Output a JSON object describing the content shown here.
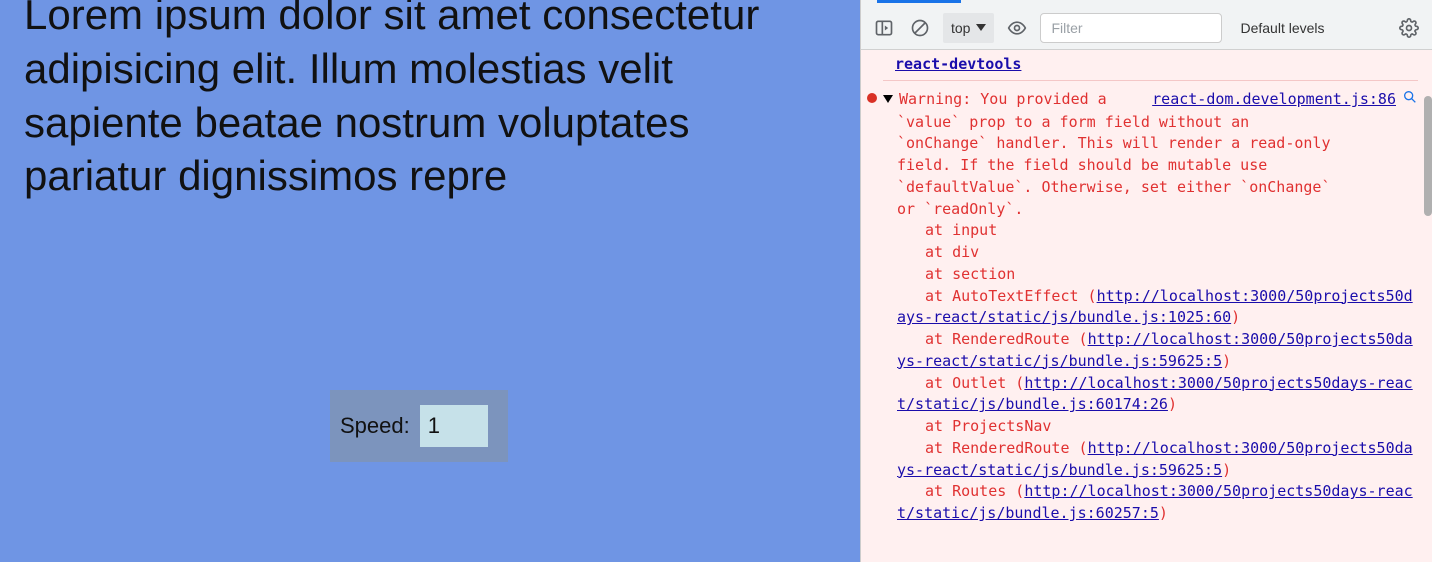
{
  "app": {
    "typing_text": "Lorem ipsum dolor sit amet consectetur adipisicing elit. Illum molestias velit sapiente beatae nostrum voluptates pariatur dignissimos repre",
    "speed_label": "Speed:",
    "speed_value": "1"
  },
  "devtools": {
    "toolbar": {
      "context": "top",
      "filter_placeholder": "Filter",
      "levels_label": "Default levels"
    },
    "prev_entry_link": "react-devtools",
    "warning": {
      "head_text": "Warning: You provided a",
      "source_link": "react-dom.development.js:86",
      "body_lines": [
        "`value` prop to a form field without an",
        "`onChange` handler. This will render a read-only",
        "field. If the field should be mutable use",
        "`defaultValue`. Otherwise, set either `onChange`",
        "or `readOnly`."
      ],
      "stack": [
        {
          "indent": true,
          "prefix": "at input",
          "url": ""
        },
        {
          "indent": true,
          "prefix": "at div",
          "url": ""
        },
        {
          "indent": true,
          "prefix": "at section",
          "url": ""
        },
        {
          "indent": true,
          "prefix": "at AutoTextEffect (",
          "url": "http://localhost:3000/50projects50days-react/static/js/bundle.js:1025:60",
          "suffix": ")"
        },
        {
          "indent": true,
          "prefix": "at RenderedRoute (",
          "url": "http://localhost:3000/50projects50days-react/static/js/bundle.js:59625:5",
          "suffix": ")"
        },
        {
          "indent": true,
          "prefix": "at Outlet (",
          "url": "http://localhost:3000/50projects50days-react/static/js/bundle.js:60174:26",
          "suffix": ")"
        },
        {
          "indent": true,
          "prefix": "at ProjectsNav",
          "url": ""
        },
        {
          "indent": true,
          "prefix": "at RenderedRoute (",
          "url": "http://localhost:3000/50projects50days-react/static/js/bundle.js:59625:5",
          "suffix": ")"
        },
        {
          "indent": true,
          "prefix": "at Routes (",
          "url": "http://localhost:3000/50projects50days-react/static/js/bundle.js:60257:5",
          "suffix": ")"
        }
      ]
    }
  }
}
